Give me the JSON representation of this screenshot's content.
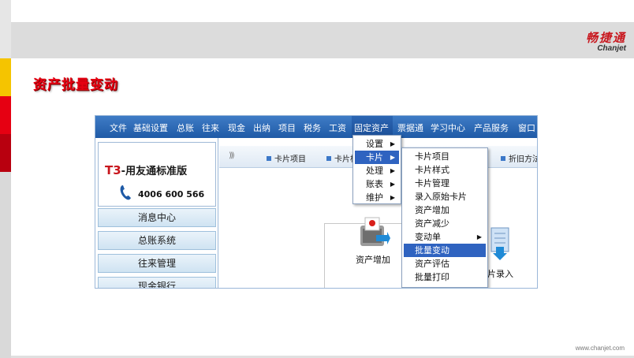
{
  "slide": {
    "title": "资产批量变动",
    "logo_cn": "畅捷通",
    "logo_en": "Chanjet",
    "footer_url": "www.chanjet.com",
    "strip_colors": [
      "#e6e6e6",
      "#f5c400",
      "#e60012",
      "#b8000f",
      "#d9d9d9"
    ]
  },
  "app": {
    "menubar": [
      "文件",
      "基础设置",
      "总账",
      "往来",
      "现金",
      "出纳",
      "项目",
      "税务",
      "工资",
      "固定资产",
      "票据通",
      "学习中心",
      "产品服务",
      "窗口"
    ],
    "active_menu": "固定资产",
    "brand_title_prefix": "T3",
    "brand_title_rest": "-用友通标准版",
    "brand_phone": "4006 600 566",
    "nav": [
      "消息中心",
      "总账系统",
      "往来管理",
      "现金银行"
    ],
    "toolbar": [
      "卡片项目",
      "卡片样",
      "折旧方法"
    ],
    "workspace": {
      "asset_add": "资产增加",
      "card_entry": "原始卡片录入"
    },
    "dropdown_main": [
      {
        "label": "设置",
        "submenu": true
      },
      {
        "label": "卡片",
        "submenu": true,
        "selected": true
      },
      {
        "label": "处理",
        "submenu": true
      },
      {
        "label": "账表",
        "submenu": true
      },
      {
        "label": "维护",
        "submenu": true
      }
    ],
    "dropdown_card": [
      {
        "label": "卡片项目"
      },
      {
        "label": "卡片样式"
      },
      {
        "label": "卡片管理"
      },
      {
        "label": "录入原始卡片"
      },
      {
        "label": "资产增加"
      },
      {
        "label": "资产减少"
      },
      {
        "label": "变动单",
        "submenu": true
      },
      {
        "label": "批量变动",
        "selected": true
      },
      {
        "label": "资产评估"
      },
      {
        "label": "批量打印"
      }
    ],
    "colors": {
      "menubar": "#2a67b5",
      "selection": "#2f63c0",
      "brand_red": "#c8161d"
    }
  }
}
